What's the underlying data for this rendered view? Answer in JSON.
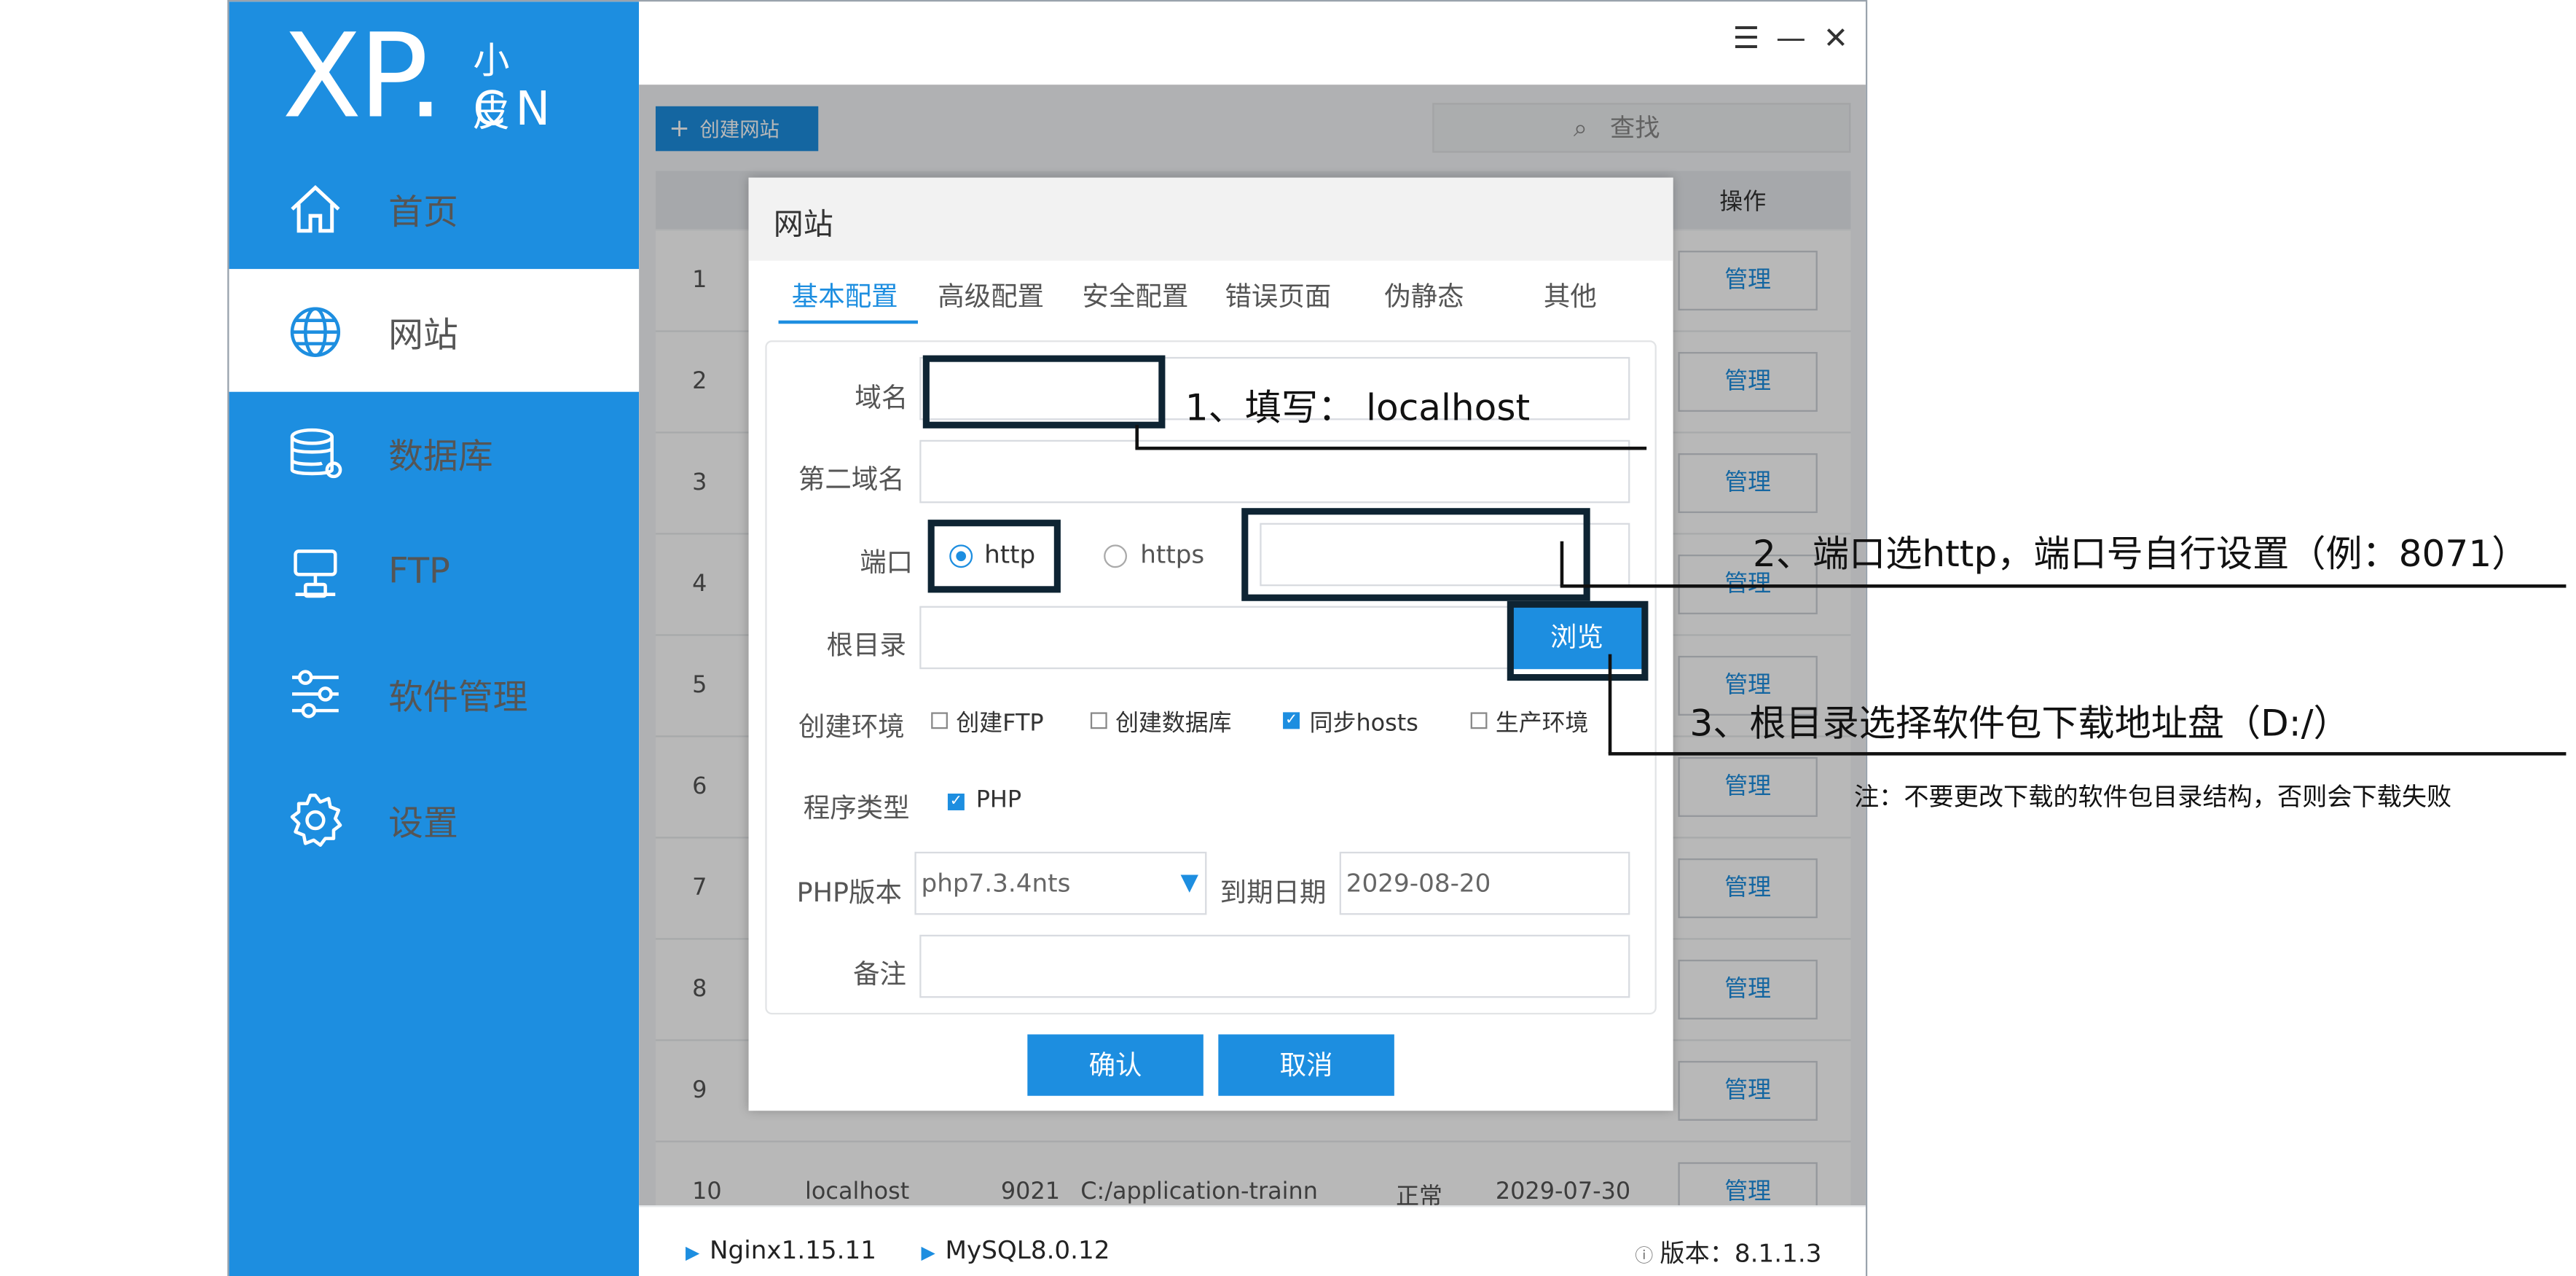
{
  "logo": {
    "main": "XP",
    "dot": ".",
    "small": "小皮",
    "cn": "CN"
  },
  "sidebar": {
    "items": [
      {
        "label": "首页",
        "icon": "home-icon"
      },
      {
        "label": "网站",
        "icon": "globe-icon",
        "active": true
      },
      {
        "label": "数据库",
        "icon": "database-icon"
      },
      {
        "label": "FTP",
        "icon": "ftp-icon"
      },
      {
        "label": "软件管理",
        "icon": "sliders-icon"
      },
      {
        "label": "设置",
        "icon": "gear-icon"
      }
    ]
  },
  "window_controls": {
    "menu": "☰",
    "minimize": "—",
    "close": "✕"
  },
  "toolbar": {
    "create_label": "创建网站",
    "search_placeholder": "查找"
  },
  "table": {
    "op_header": "操作",
    "manage_label": "管理",
    "rows": [
      "1",
      "2",
      "3",
      "4",
      "5",
      "6",
      "7",
      "8",
      "9",
      "10"
    ],
    "last_row": {
      "name": "localhost",
      "port": "9021",
      "path": "C:/application-trainn",
      "status": "正常",
      "date": "2029-07-30"
    }
  },
  "statusbar": {
    "nginx": "Nginx1.15.11",
    "mysql": "MySQL8.0.12",
    "version": "版本：8.1.1.3"
  },
  "dialog": {
    "title": "网站",
    "tabs": [
      "基本配置",
      "高级配置",
      "安全配置",
      "错误页面",
      "伪静态",
      "其他"
    ],
    "labels": {
      "domain": "域名",
      "second_domain": "第二域名",
      "port": "端口",
      "root": "根目录",
      "env": "创建环境",
      "program": "程序类型",
      "php_version": "PHP版本",
      "expire": "到期日期",
      "note": "备注"
    },
    "port_options": [
      "http",
      "https"
    ],
    "browse_label": "浏览",
    "env_options": [
      "创建FTP",
      "创建数据库",
      "同步hosts",
      "生产环境"
    ],
    "program_option": "PHP",
    "php_version_value": "php7.3.4nts",
    "expire_value": "2029-08-20",
    "confirm_label": "确认",
    "cancel_label": "取消"
  },
  "annotations": {
    "step1": "1、填写：  localhost",
    "step2": "2、端口选http，端口号自行设置（例：8071）",
    "step3": "3、根目录选择软件包下载地址盘（D:/）",
    "note": "注：不要更改下载的软件包目录结构，否则会下载失败"
  }
}
